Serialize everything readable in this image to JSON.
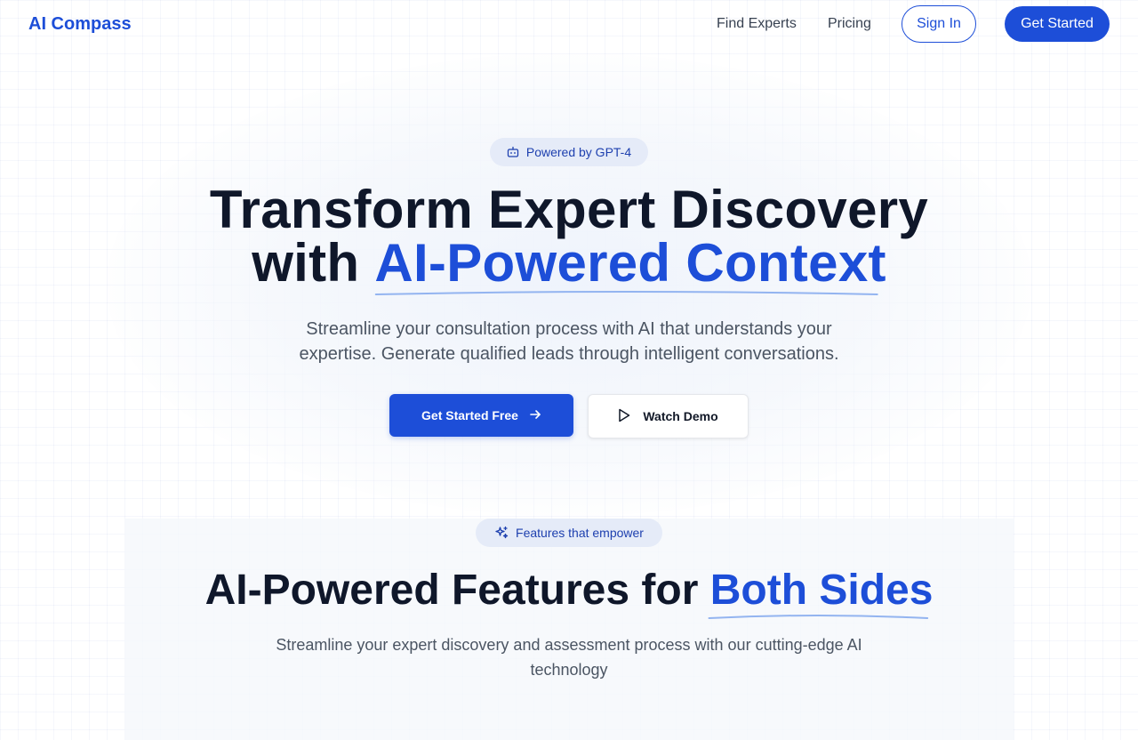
{
  "header": {
    "logo": "AI Compass",
    "nav": {
      "find_experts": "Find Experts",
      "pricing": "Pricing"
    },
    "sign_in": "Sign In",
    "get_started": "Get Started"
  },
  "hero": {
    "badge": {
      "icon": "robot-icon",
      "label": "Powered by GPT-4"
    },
    "title_line1": "Transform Expert Discovery",
    "title_line2_prefix": "with ",
    "title_line2_accent": "AI-Powered Context",
    "subtitle": "Streamline your consultation process with AI that understands your expertise. Generate qualified leads through intelligent conversations.",
    "primary_cta": {
      "label": "Get Started Free",
      "icon": "arrow-right-icon"
    },
    "secondary_cta": {
      "label": "Watch Demo",
      "icon": "play-icon"
    }
  },
  "features": {
    "badge": {
      "icon": "sparkles-icon",
      "label": "Features that empower"
    },
    "title_prefix": "AI-Powered Features for ",
    "title_accent": "Both Sides",
    "subtitle": "Streamline your expert discovery and assessment process with our cutting-edge AI technology"
  },
  "colors": {
    "brand": "#1d4ed8",
    "heading": "#0f172a",
    "body_text": "#4b5563",
    "badge_bg": "#e5ebf8"
  }
}
